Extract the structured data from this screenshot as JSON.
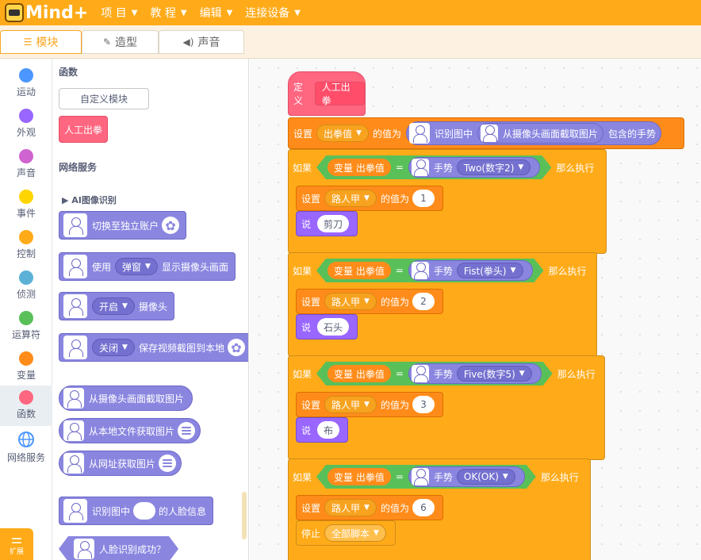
{
  "app": {
    "logo": "Mind+"
  },
  "menu": [
    {
      "label": "项 目"
    },
    {
      "label": "教 程"
    },
    {
      "label": "编辑"
    },
    {
      "label": "连接设备"
    }
  ],
  "tabs": [
    {
      "label": "模块",
      "icon": "puzzle-icon"
    },
    {
      "label": "造型",
      "icon": "brush-icon"
    },
    {
      "label": "声音",
      "icon": "speaker-icon"
    }
  ],
  "categories": [
    {
      "label": "运动",
      "color": "#4c97ff"
    },
    {
      "label": "外观",
      "color": "#9966ff"
    },
    {
      "label": "声音",
      "color": "#cf63cf"
    },
    {
      "label": "事件",
      "color": "#ffd500"
    },
    {
      "label": "控制",
      "color": "#ffab19"
    },
    {
      "label": "侦测",
      "color": "#5cb1d6"
    },
    {
      "label": "运算符",
      "color": "#59c059"
    },
    {
      "label": "变量",
      "color": "#ff8c1a"
    },
    {
      "label": "函数",
      "color": "#ff6680"
    },
    {
      "label": "网络服务",
      "color": "#4c97ff"
    }
  ],
  "extension": {
    "label": "扩展"
  },
  "palette": {
    "functions_title": "函数",
    "custom_block_button": "自定义模块",
    "function_block": "人工出拳",
    "network_title": "网络服务",
    "ai_section": "AI图像识别",
    "blocks": {
      "switch_account": "切换至独立账户",
      "use": "使用",
      "popup": "弹窗",
      "show_camera": "显示摄像头画面",
      "open": "开启",
      "camera": "摄像头",
      "close": "关闭",
      "save_snapshot": "保存视频截图到本地",
      "capture_from_camera": "从摄像头画面截取图片",
      "from_local_file": "从本地文件获取图片",
      "from_url": "从网址获取图片",
      "recognize_in": "识别图中",
      "face_info": "的人脸信息",
      "face_success": "人脸识别成功？"
    }
  },
  "script": {
    "define": "定义",
    "define_name": "人工出拳",
    "set": "设置",
    "var_punch": "出拳值",
    "set_to": "的值为",
    "recognize_in": "识别图中",
    "capture": "从摄像头画面截取图片",
    "contains_gesture": "包含的手势",
    "if": "如果",
    "var_label": "变量 出拳值",
    "equals": "=",
    "gesture": "手势",
    "then": "那么执行",
    "var_person": "路人甲",
    "say": "说",
    "stop": "停止",
    "all_scripts": "全部脚本",
    "cases": [
      {
        "gesture": "Two(数字2)",
        "value": "1",
        "say": "剪刀"
      },
      {
        "gesture": "Fist(拳头)",
        "value": "2",
        "say": "石头"
      },
      {
        "gesture": "Five(数字5)",
        "value": "3",
        "say": "布"
      },
      {
        "gesture": "OK(OK)",
        "value": "6"
      }
    ]
  }
}
